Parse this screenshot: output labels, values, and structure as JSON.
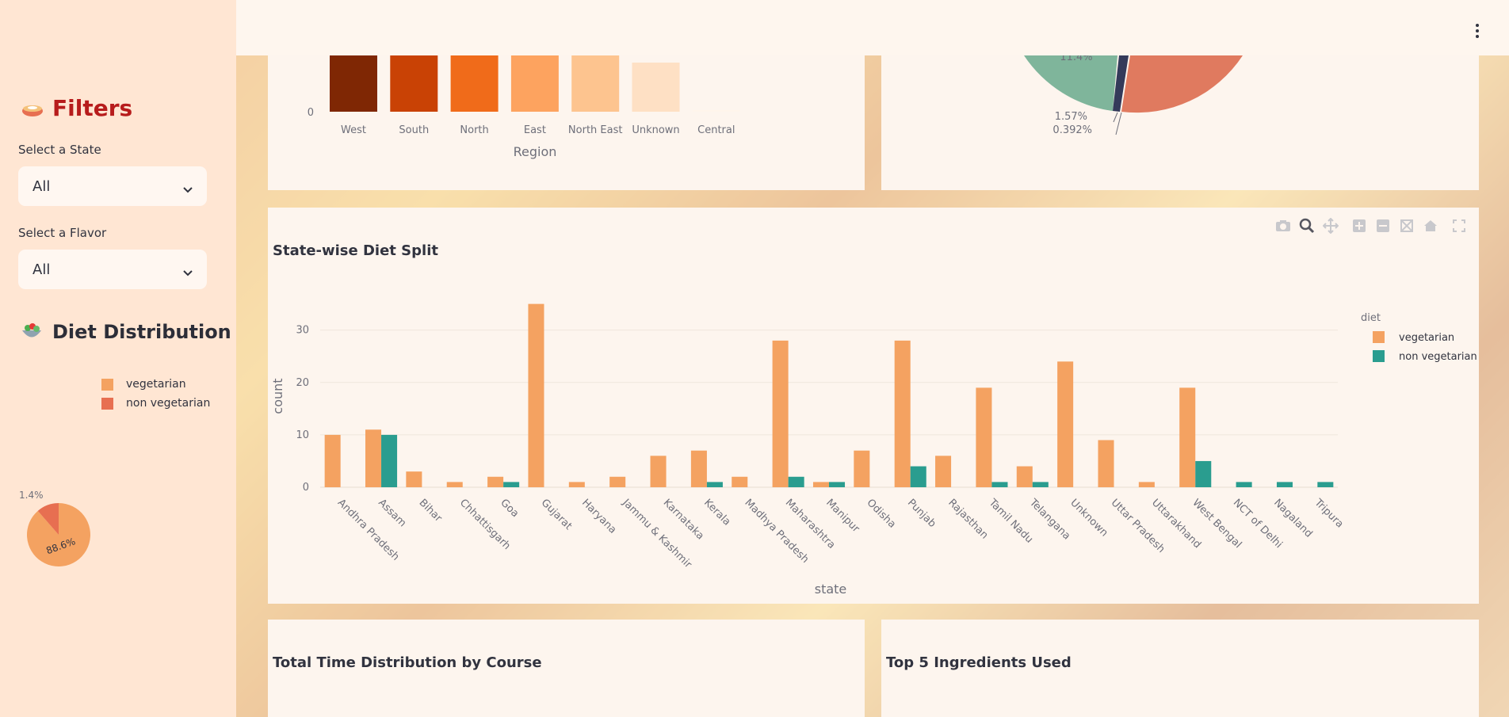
{
  "sidebar": {
    "filters_title": "Filters",
    "state_label": "Select a State",
    "state_value": "All",
    "flavor_label": "Select a Flavor",
    "flavor_value": "All",
    "diet_title": "Diet Distribution",
    "legend": [
      {
        "label": "vegetarian",
        "color": "#f4a261"
      },
      {
        "label": "non vegetarian",
        "color": "#e76f51"
      }
    ],
    "pie": {
      "slices": [
        {
          "label": "vegetarian",
          "value": 88.6,
          "text": "88.6%",
          "color": "#f4a261"
        },
        {
          "label": "non vegetarian",
          "value": 11.4,
          "text": "1.4%",
          "color": "#e76f51"
        }
      ]
    }
  },
  "region_chart": {
    "xlabel": "Region",
    "ytick_zero": "0",
    "categories": [
      "West",
      "South",
      "North",
      "East",
      "North East",
      "Unknown",
      "Central"
    ],
    "colors": [
      "#7f2704",
      "#c94205",
      "#f06b1a",
      "#fda35f",
      "#fdc48f",
      "#fee0c4",
      "#fff5eb"
    ]
  },
  "region_pie": {
    "labels": [
      "11.4%",
      "1.57%",
      "0.392%"
    ],
    "colors": {
      "green": "#7fb59b",
      "navy": "#343a5a",
      "salmon": "#e07a5f"
    }
  },
  "diet_split": {
    "title": "State-wise Diet Split",
    "legend_title": "diet",
    "modebar_icons": [
      "camera-icon",
      "zoom-icon",
      "pan-icon",
      "zoom-in-icon",
      "zoom-out-icon",
      "autoscale-icon",
      "home-icon",
      "fullscreen-icon"
    ]
  },
  "chart_data": {
    "type": "bar",
    "title": "State-wise Diet Split",
    "xlabel": "state",
    "ylabel": "count",
    "ylim": [
      0,
      36
    ],
    "yticks": [
      0,
      10,
      20,
      30
    ],
    "grid": true,
    "legend_title": "diet",
    "legend_position": "top-right",
    "categories": [
      "Andhra Pradesh",
      "Assam",
      "Bihar",
      "Chhattisgarh",
      "Goa",
      "Gujarat",
      "Haryana",
      "Jammu & Kashmir",
      "Karnataka",
      "Kerala",
      "Madhya Pradesh",
      "Maharashtra",
      "Manipur",
      "Odisha",
      "Punjab",
      "Rajasthan",
      "Tamil Nadu",
      "Telangana",
      "Unknown",
      "Uttar Pradesh",
      "Uttarakhand",
      "West Bengal",
      "NCT of Delhi",
      "Nagaland",
      "Tripura"
    ],
    "series": [
      {
        "name": "vegetarian",
        "color": "#f4a261",
        "values": [
          10,
          11,
          3,
          1,
          2,
          35,
          1,
          2,
          6,
          7,
          2,
          28,
          1,
          7,
          28,
          6,
          19,
          4,
          24,
          9,
          1,
          19,
          0,
          0,
          0
        ]
      },
      {
        "name": "non vegetarian",
        "color": "#2a9d8f",
        "values": [
          0,
          10,
          0,
          0,
          1,
          0,
          0,
          0,
          0,
          1,
          0,
          2,
          1,
          0,
          4,
          0,
          1,
          1,
          0,
          0,
          0,
          5,
          1,
          1,
          1
        ]
      }
    ]
  },
  "bottom_left": {
    "title": "Total Time Distribution by Course"
  },
  "bottom_right": {
    "title": "Top 5 Ingredients Used"
  }
}
